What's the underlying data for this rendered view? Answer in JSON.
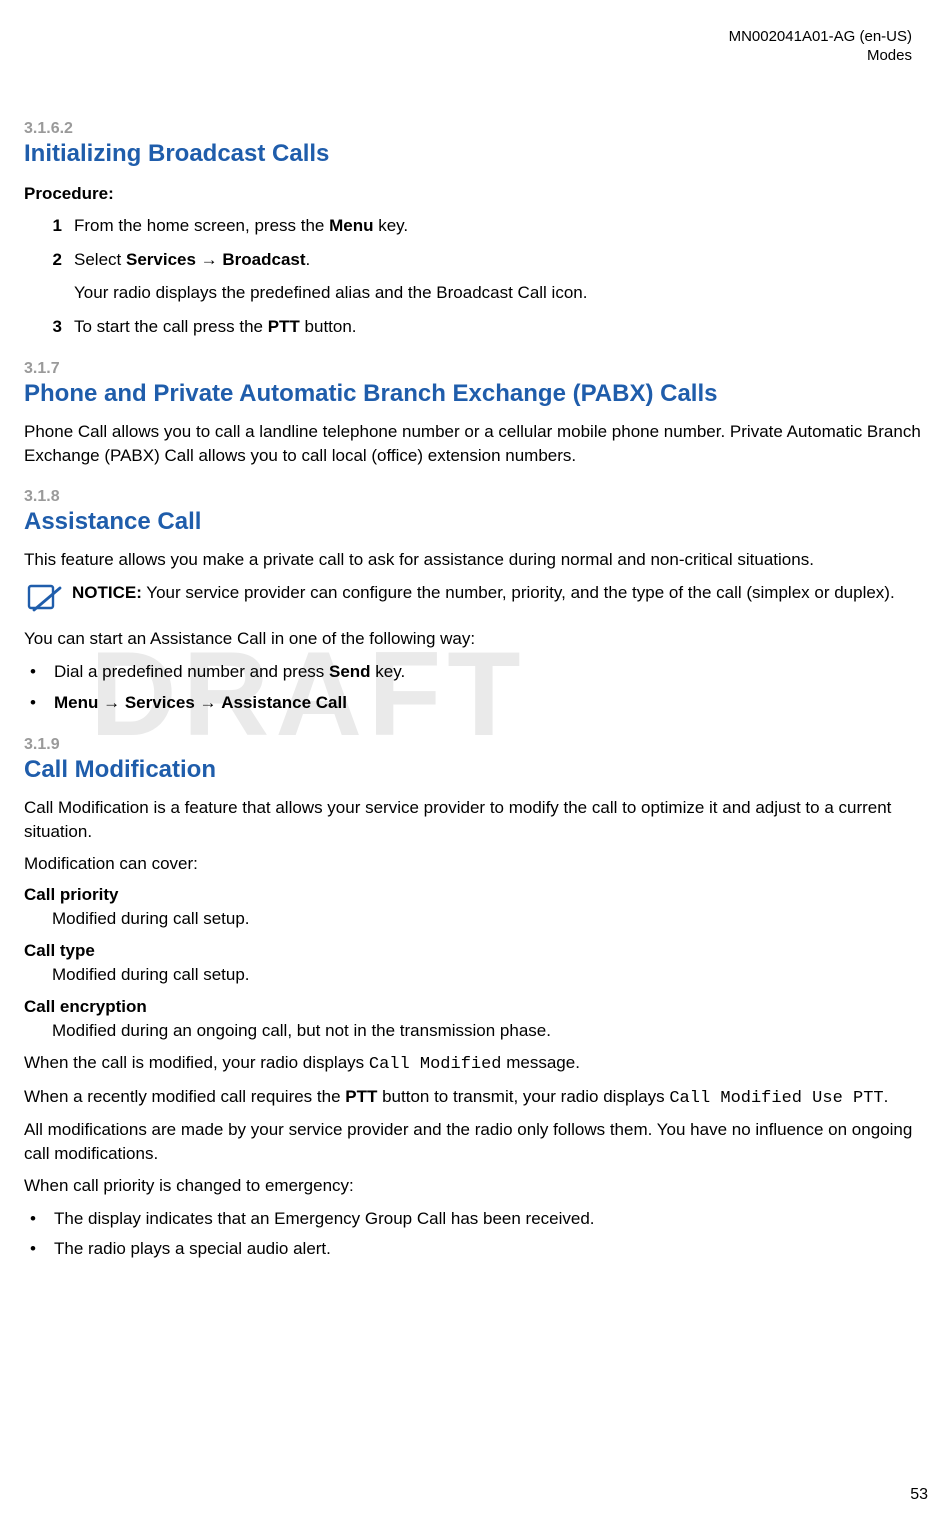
{
  "header": {
    "doc_id": "MN002041A01-AG (en-US)",
    "section_name": "Modes"
  },
  "watermark": "DRAFT",
  "page_number": "53",
  "sec_3162": {
    "num": "3.1.6.2",
    "title": "Initializing Broadcast Calls",
    "procedure_label": "Procedure:",
    "steps": {
      "s1": {
        "num": "1",
        "pre": "From the home screen, press the ",
        "b": "Menu",
        "post": " key."
      },
      "s2": {
        "num": "2",
        "pre": "Select ",
        "b1": "Services",
        "arrow": " → ",
        "b2": "Broadcast",
        "post": ".",
        "extra": "Your radio displays the predefined alias and the Broadcast Call icon."
      },
      "s3": {
        "num": "3",
        "pre": "To start the call press the ",
        "b": "PTT",
        "post": " button."
      }
    }
  },
  "sec_317": {
    "num": "3.1.7",
    "title": "Phone and Private Automatic Branch Exchange (PABX) Calls",
    "body": "Phone Call allows you to call a landline telephone number or a cellular mobile phone number. Private Automatic Branch Exchange (PABX) Call allows you to call local (office) extension numbers."
  },
  "sec_318": {
    "num": "3.1.8",
    "title": "Assistance Call",
    "body1": "This feature allows you make a private call to ask for assistance during normal and non-critical situations.",
    "notice": {
      "label": "NOTICE:",
      "text": " Your service provider can configure the number, priority, and the type of the call (simplex or duplex)."
    },
    "body2": "You can start an Assistance Call in one of the following way:",
    "bullets": {
      "b1": {
        "pre": "Dial a predefined number and press ",
        "b": "Send",
        "post": " key."
      },
      "b2": {
        "b1": "Menu",
        "a1": " → ",
        "b2": "Services",
        "a2": " → ",
        "b3": "Assistance Call"
      }
    }
  },
  "sec_319": {
    "num": "3.1.9",
    "title": "Call Modification",
    "body1": "Call Modification is a feature that allows your service provider to modify the call to optimize it and adjust to a current situation.",
    "body2": "Modification can cover:",
    "terms": {
      "t1": {
        "term": "Call priority",
        "desc": "Modified during call setup."
      },
      "t2": {
        "term": "Call type",
        "desc": "Modified during call setup."
      },
      "t3": {
        "term": "Call encryption",
        "desc": "Modified during an ongoing call, but not in the transmission phase."
      }
    },
    "p_modified": {
      "pre": "When the call is modified, your radio displays ",
      "mono": "Call Modified",
      "post": " message."
    },
    "p_useptt": {
      "pre": "When a recently modified call requires the ",
      "b": "PTT",
      "mid": " button to transmit, your radio displays ",
      "mono": "Call Modified Use PTT",
      "post": "."
    },
    "body3": "All modifications are made by your service provider and the radio only follows them. You have no influence on ongoing call modifications.",
    "body4": "When call priority is changed to emergency:",
    "bullets2": {
      "b1": "The display indicates that an Emergency Group Call has been received.",
      "b2": "The radio plays a special audio alert."
    }
  }
}
